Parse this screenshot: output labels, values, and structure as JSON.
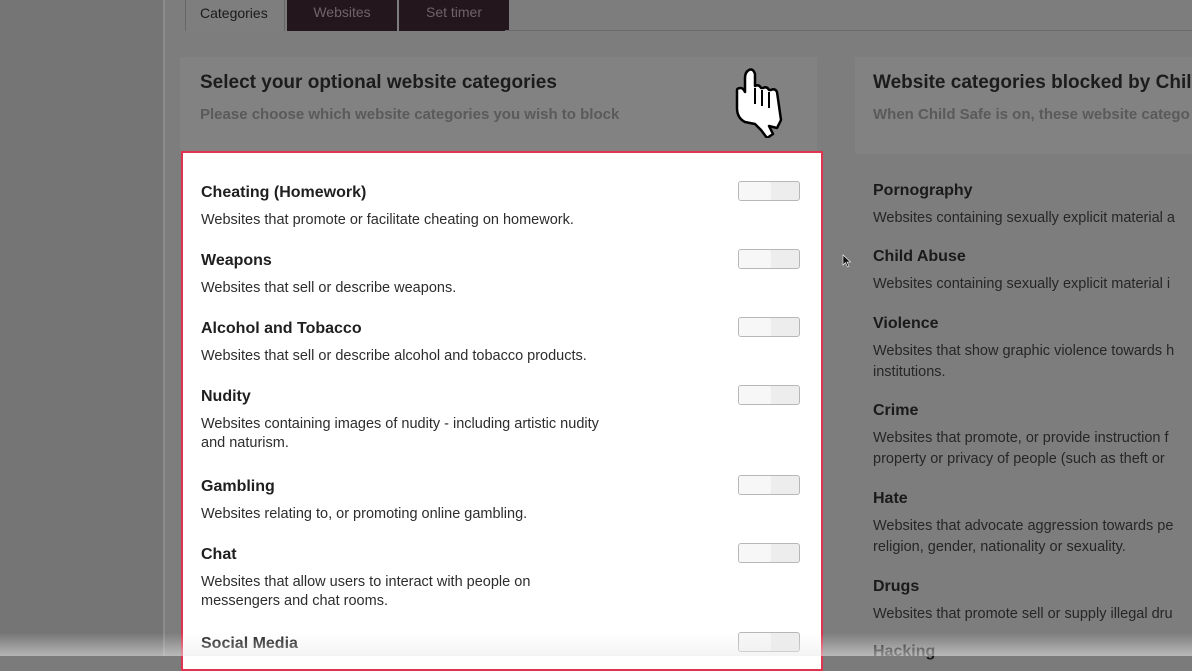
{
  "tabs": [
    "Categories",
    "Websites",
    "Set timer"
  ],
  "left_header": {
    "title": "Select your optional website categories",
    "subtitle": "Please choose which website categories you wish to block"
  },
  "right_header": {
    "title": "Website categories blocked by Chil",
    "subtitle": "When Child Safe is on, these website catego"
  },
  "optional_categories": [
    {
      "name": "Cheating (Homework)",
      "desc": "Websites that promote or facilitate cheating on homework.",
      "enabled": false
    },
    {
      "name": "Weapons",
      "desc": "Websites that sell or describe weapons.",
      "enabled": false
    },
    {
      "name": "Alcohol and Tobacco",
      "desc": "Websites that sell or describe alcohol and tobacco products.",
      "enabled": false
    },
    {
      "name": "Nudity",
      "desc": "Websites containing images of nudity - including artistic nudity\nand naturism.",
      "enabled": false
    },
    {
      "name": "Gambling",
      "desc": "Websites relating to, or promoting online gambling.",
      "enabled": false
    },
    {
      "name": "Chat",
      "desc": "Websites that allow users to interact with people on\nmessengers and chat rooms.",
      "enabled": false
    },
    {
      "name": "Social Media",
      "desc": "",
      "enabled": false
    }
  ],
  "blocked_categories": [
    {
      "name": "Pornography",
      "desc": "Websites containing sexually explicit material a"
    },
    {
      "name": "Child Abuse",
      "desc": "Websites containing sexually explicit material i"
    },
    {
      "name": "Violence",
      "desc": "Websites that show graphic violence towards h\ninstitutions."
    },
    {
      "name": "Crime",
      "desc": "Websites that promote, or provide instruction f\nproperty or privacy of people (such as theft or"
    },
    {
      "name": "Hate",
      "desc": "Websites that advocate aggression towards pe\nreligion, gender, nationality or sexuality."
    },
    {
      "name": "Drugs",
      "desc": "Websites that promote sell or supply illegal dru"
    },
    {
      "name": "Hacking",
      "desc": ""
    }
  ],
  "colors": {
    "panel_border": "#e0334f",
    "tab_dark": "#23161d"
  },
  "icons": {
    "hand": "hand-pointer-icon",
    "cursor": "mouse-pointer-icon"
  }
}
